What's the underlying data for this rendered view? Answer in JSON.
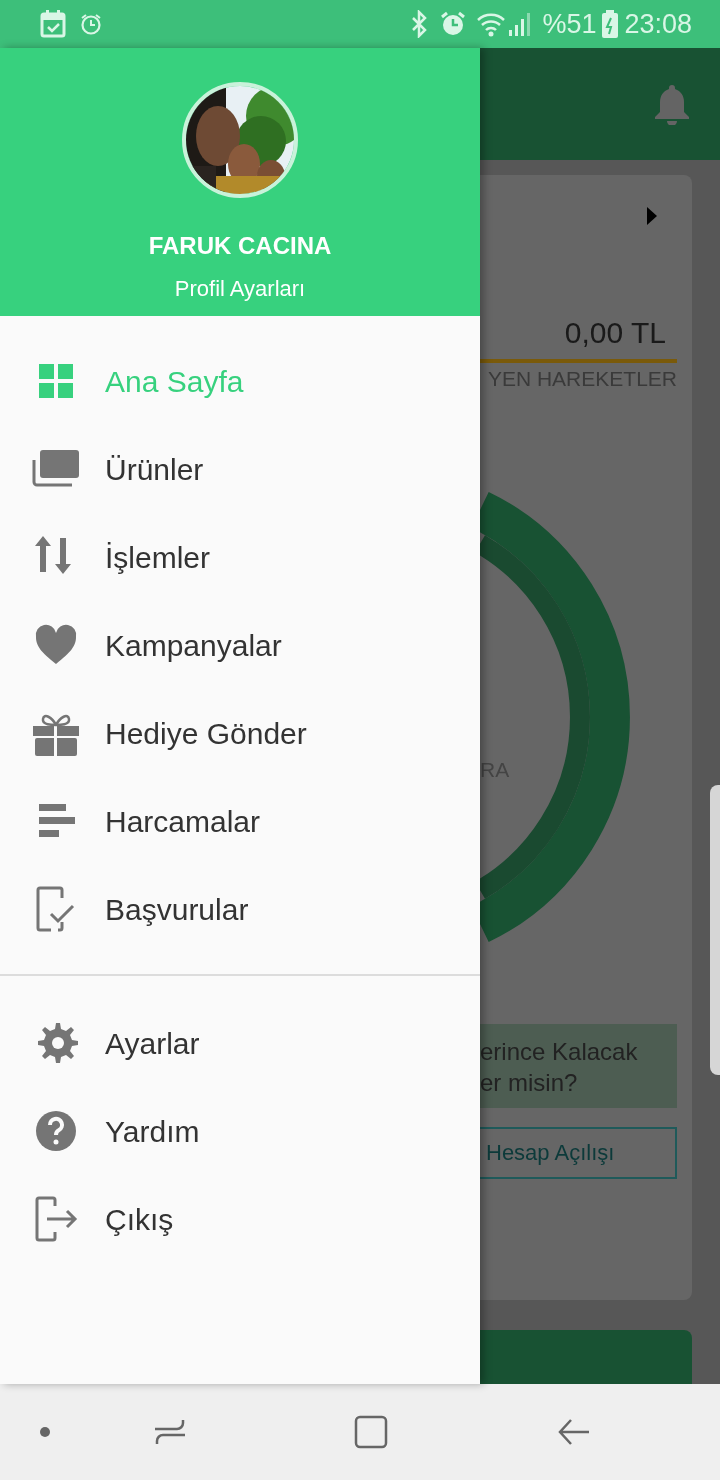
{
  "status_bar": {
    "battery": "%51",
    "time": "23:08"
  },
  "profile": {
    "name": "FARUK CACINA",
    "link": "Profil Ayarları"
  },
  "menu": [
    {
      "label": "Ana Sayfa",
      "selected": true
    },
    {
      "label": "Ürünler",
      "selected": false
    },
    {
      "label": "İşlemler",
      "selected": false
    },
    {
      "label": "Kampanyalar",
      "selected": false
    },
    {
      "label": "Hediye Gönder",
      "selected": false
    },
    {
      "label": "Harcamalar",
      "selected": false
    },
    {
      "label": "Başvurular",
      "selected": false
    }
  ],
  "menu_secondary": [
    {
      "label": "Ayarlar",
      "selected": false
    },
    {
      "label": "Yardım",
      "selected": false
    },
    {
      "label": "Çıkış",
      "selected": false
    }
  ],
  "background_screen": {
    "balance": "0,00 TL",
    "section_label": "YEN HAREKETLER",
    "chart_label": "RA",
    "banner_lines": [
      "erince Kalacak",
      "er misin?"
    ],
    "button": "Hesap Açılışı"
  }
}
